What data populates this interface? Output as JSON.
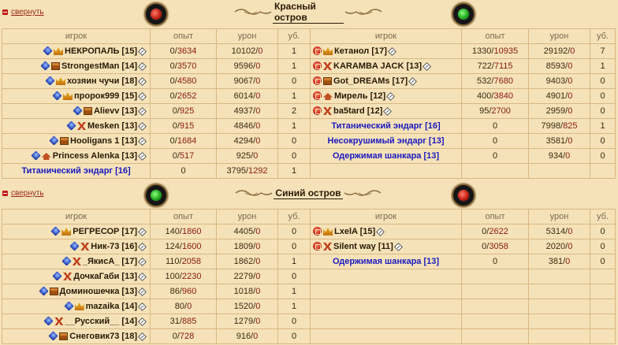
{
  "sections": [
    {
      "collapse_label": "свернуть",
      "title": "Красный остров",
      "headers": {
        "player": "игрок",
        "exp": "опыт",
        "dmg": "урон",
        "kills": "уб."
      },
      "left": [
        {
          "name": "НЕКРОПАЛЬ [15]",
          "align": "align-blue",
          "rank": "crown",
          "exp_a": "0",
          "exp_b": "3634",
          "dmg_a": "10102",
          "dmg_b": "0",
          "kills": "1"
        },
        {
          "name": "StrongestMan [14]",
          "align": "align-blue",
          "rank": "chest",
          "exp_a": "0",
          "exp_b": "3570",
          "dmg_a": "9596",
          "dmg_b": "0",
          "kills": "1"
        },
        {
          "name": "хозяин чучи [18]",
          "align": "align-blue",
          "rank": "crown",
          "exp_a": "0",
          "exp_b": "4580",
          "dmg_a": "9067",
          "dmg_b": "0",
          "kills": "0"
        },
        {
          "name": "пророк999 [15]",
          "align": "align-blue",
          "rank": "crown",
          "exp_a": "0",
          "exp_b": "2652",
          "dmg_a": "6014",
          "dmg_b": "0",
          "kills": "1"
        },
        {
          "name": "Alievv [13]",
          "align": "align-blue",
          "rank": "chest",
          "exp_a": "0",
          "exp_b": "925",
          "dmg_a": "4937",
          "dmg_b": "0",
          "kills": "2"
        },
        {
          "name": "Mesken [13]",
          "align": "align-blue",
          "rank": "mark",
          "exp_a": "0",
          "exp_b": "915",
          "dmg_a": "4846",
          "dmg_b": "0",
          "kills": "1"
        },
        {
          "name": "Hooligans 1 [13]",
          "align": "align-blue",
          "rank": "chest",
          "exp_a": "0",
          "exp_b": "1684",
          "dmg_a": "4294",
          "dmg_b": "0",
          "kills": "0"
        },
        {
          "name": "Princess Alenka [13]",
          "align": "align-blue",
          "rank": "hat",
          "exp_a": "0",
          "exp_b": "517",
          "dmg_a": "925",
          "dmg_b": "0",
          "kills": "0"
        },
        {
          "name": "Титанический эндарг [16]",
          "bot": true,
          "exp_a": "0",
          "dmg_a": "3795",
          "dmg_b": "1292",
          "kills": "1"
        }
      ],
      "right": [
        {
          "name": "Кетанол [17]",
          "align": "align-red",
          "rank": "crown",
          "exp_a": "1330",
          "exp_b": "10935",
          "dmg_a": "29192",
          "dmg_b": "0",
          "kills": "7"
        },
        {
          "name": "KARAMBA JACK [13]",
          "align": "align-red",
          "rank": "mark",
          "exp_a": "722",
          "exp_b": "7115",
          "dmg_a": "8593",
          "dmg_b": "0",
          "kills": "1"
        },
        {
          "name": "Got_DREAMs [17]",
          "align": "align-red",
          "rank": "chest",
          "exp_a": "532",
          "exp_b": "7680",
          "dmg_a": "9403",
          "dmg_b": "0",
          "kills": "0"
        },
        {
          "name": "Мирель [12]",
          "align": "align-red",
          "rank": "hat",
          "exp_a": "400",
          "exp_b": "3840",
          "dmg_a": "4901",
          "dmg_b": "0",
          "kills": "0"
        },
        {
          "name": "ba5tard [12]",
          "align": "align-red",
          "rank": "mark",
          "exp_a": "95",
          "exp_b": "2700",
          "dmg_a": "2959",
          "dmg_b": "0",
          "kills": "0"
        },
        {
          "name": "Титанический эндарг [16]",
          "bot": true,
          "exp_a": "0",
          "dmg_a": "7998",
          "dmg_b": "825",
          "kills": "1"
        },
        {
          "name": "Несокрушимый эндарг [13]",
          "bot": true,
          "exp_a": "0",
          "dmg_a": "3581",
          "dmg_b": "0",
          "kills": "0"
        },
        {
          "name": "Одержимая шанкара [13]",
          "bot": true,
          "exp_a": "0",
          "dmg_a": "934",
          "dmg_b": "0",
          "kills": "0"
        }
      ]
    },
    {
      "collapse_label": "свернуть",
      "title": "Синий остров",
      "headers": {
        "player": "игрок",
        "exp": "опыт",
        "dmg": "урон",
        "kills": "уб."
      },
      "left": [
        {
          "name": "РЕГРЕСОР [17]",
          "align": "align-blue",
          "rank": "crown",
          "exp_a": "140",
          "exp_b": "1860",
          "dmg_a": "4405",
          "dmg_b": "0",
          "kills": "0"
        },
        {
          "name": "Ник-73 [16]",
          "align": "align-blue",
          "rank": "mark",
          "exp_a": "124",
          "exp_b": "1600",
          "dmg_a": "1809",
          "dmg_b": "0",
          "kills": "0"
        },
        {
          "name": "_ЯкисА_ [17]",
          "align": "align-blue",
          "rank": "mark",
          "exp_a": "110",
          "exp_b": "2058",
          "dmg_a": "1862",
          "dmg_b": "0",
          "kills": "1"
        },
        {
          "name": "ДочкаГаби [13]",
          "align": "align-blue",
          "rank": "mark",
          "exp_a": "100",
          "exp_b": "2230",
          "dmg_a": "2279",
          "dmg_b": "0",
          "kills": "0"
        },
        {
          "name": "Доминошечка [13]",
          "align": "align-blue",
          "rank": "chest",
          "exp_a": "86",
          "exp_b": "960",
          "dmg_a": "1018",
          "dmg_b": "0",
          "kills": "1"
        },
        {
          "name": "mazaika [14]",
          "align": "align-blue",
          "rank": "crown",
          "exp_a": "80",
          "exp_b": "0",
          "dmg_a": "1520",
          "dmg_b": "0",
          "kills": "1"
        },
        {
          "name": "__Русский__ [14]",
          "align": "align-blue",
          "rank": "mark",
          "exp_a": "31",
          "exp_b": "885",
          "dmg_a": "1279",
          "dmg_b": "0",
          "kills": "0"
        },
        {
          "name": "Снеговик73 [18]",
          "align": "align-blue",
          "rank": "chest",
          "exp_a": "0",
          "exp_b": "728",
          "dmg_a": "916",
          "dmg_b": "0",
          "kills": "0"
        }
      ],
      "right": [
        {
          "name": "LxelA [15]",
          "align": "align-red",
          "rank": "crown",
          "exp_a": "0",
          "exp_b": "2622",
          "dmg_a": "5314",
          "dmg_b": "0",
          "kills": "0"
        },
        {
          "name": "Silent way [11]",
          "align": "align-red",
          "rank": "mark",
          "exp_a": "0",
          "exp_b": "3058",
          "dmg_a": "2020",
          "dmg_b": "0",
          "kills": "0"
        },
        {
          "name": "Одержимая шанкара [13]",
          "bot": true,
          "exp_a": "0",
          "dmg_a": "381",
          "dmg_b": "0",
          "kills": "0"
        }
      ]
    }
  ]
}
